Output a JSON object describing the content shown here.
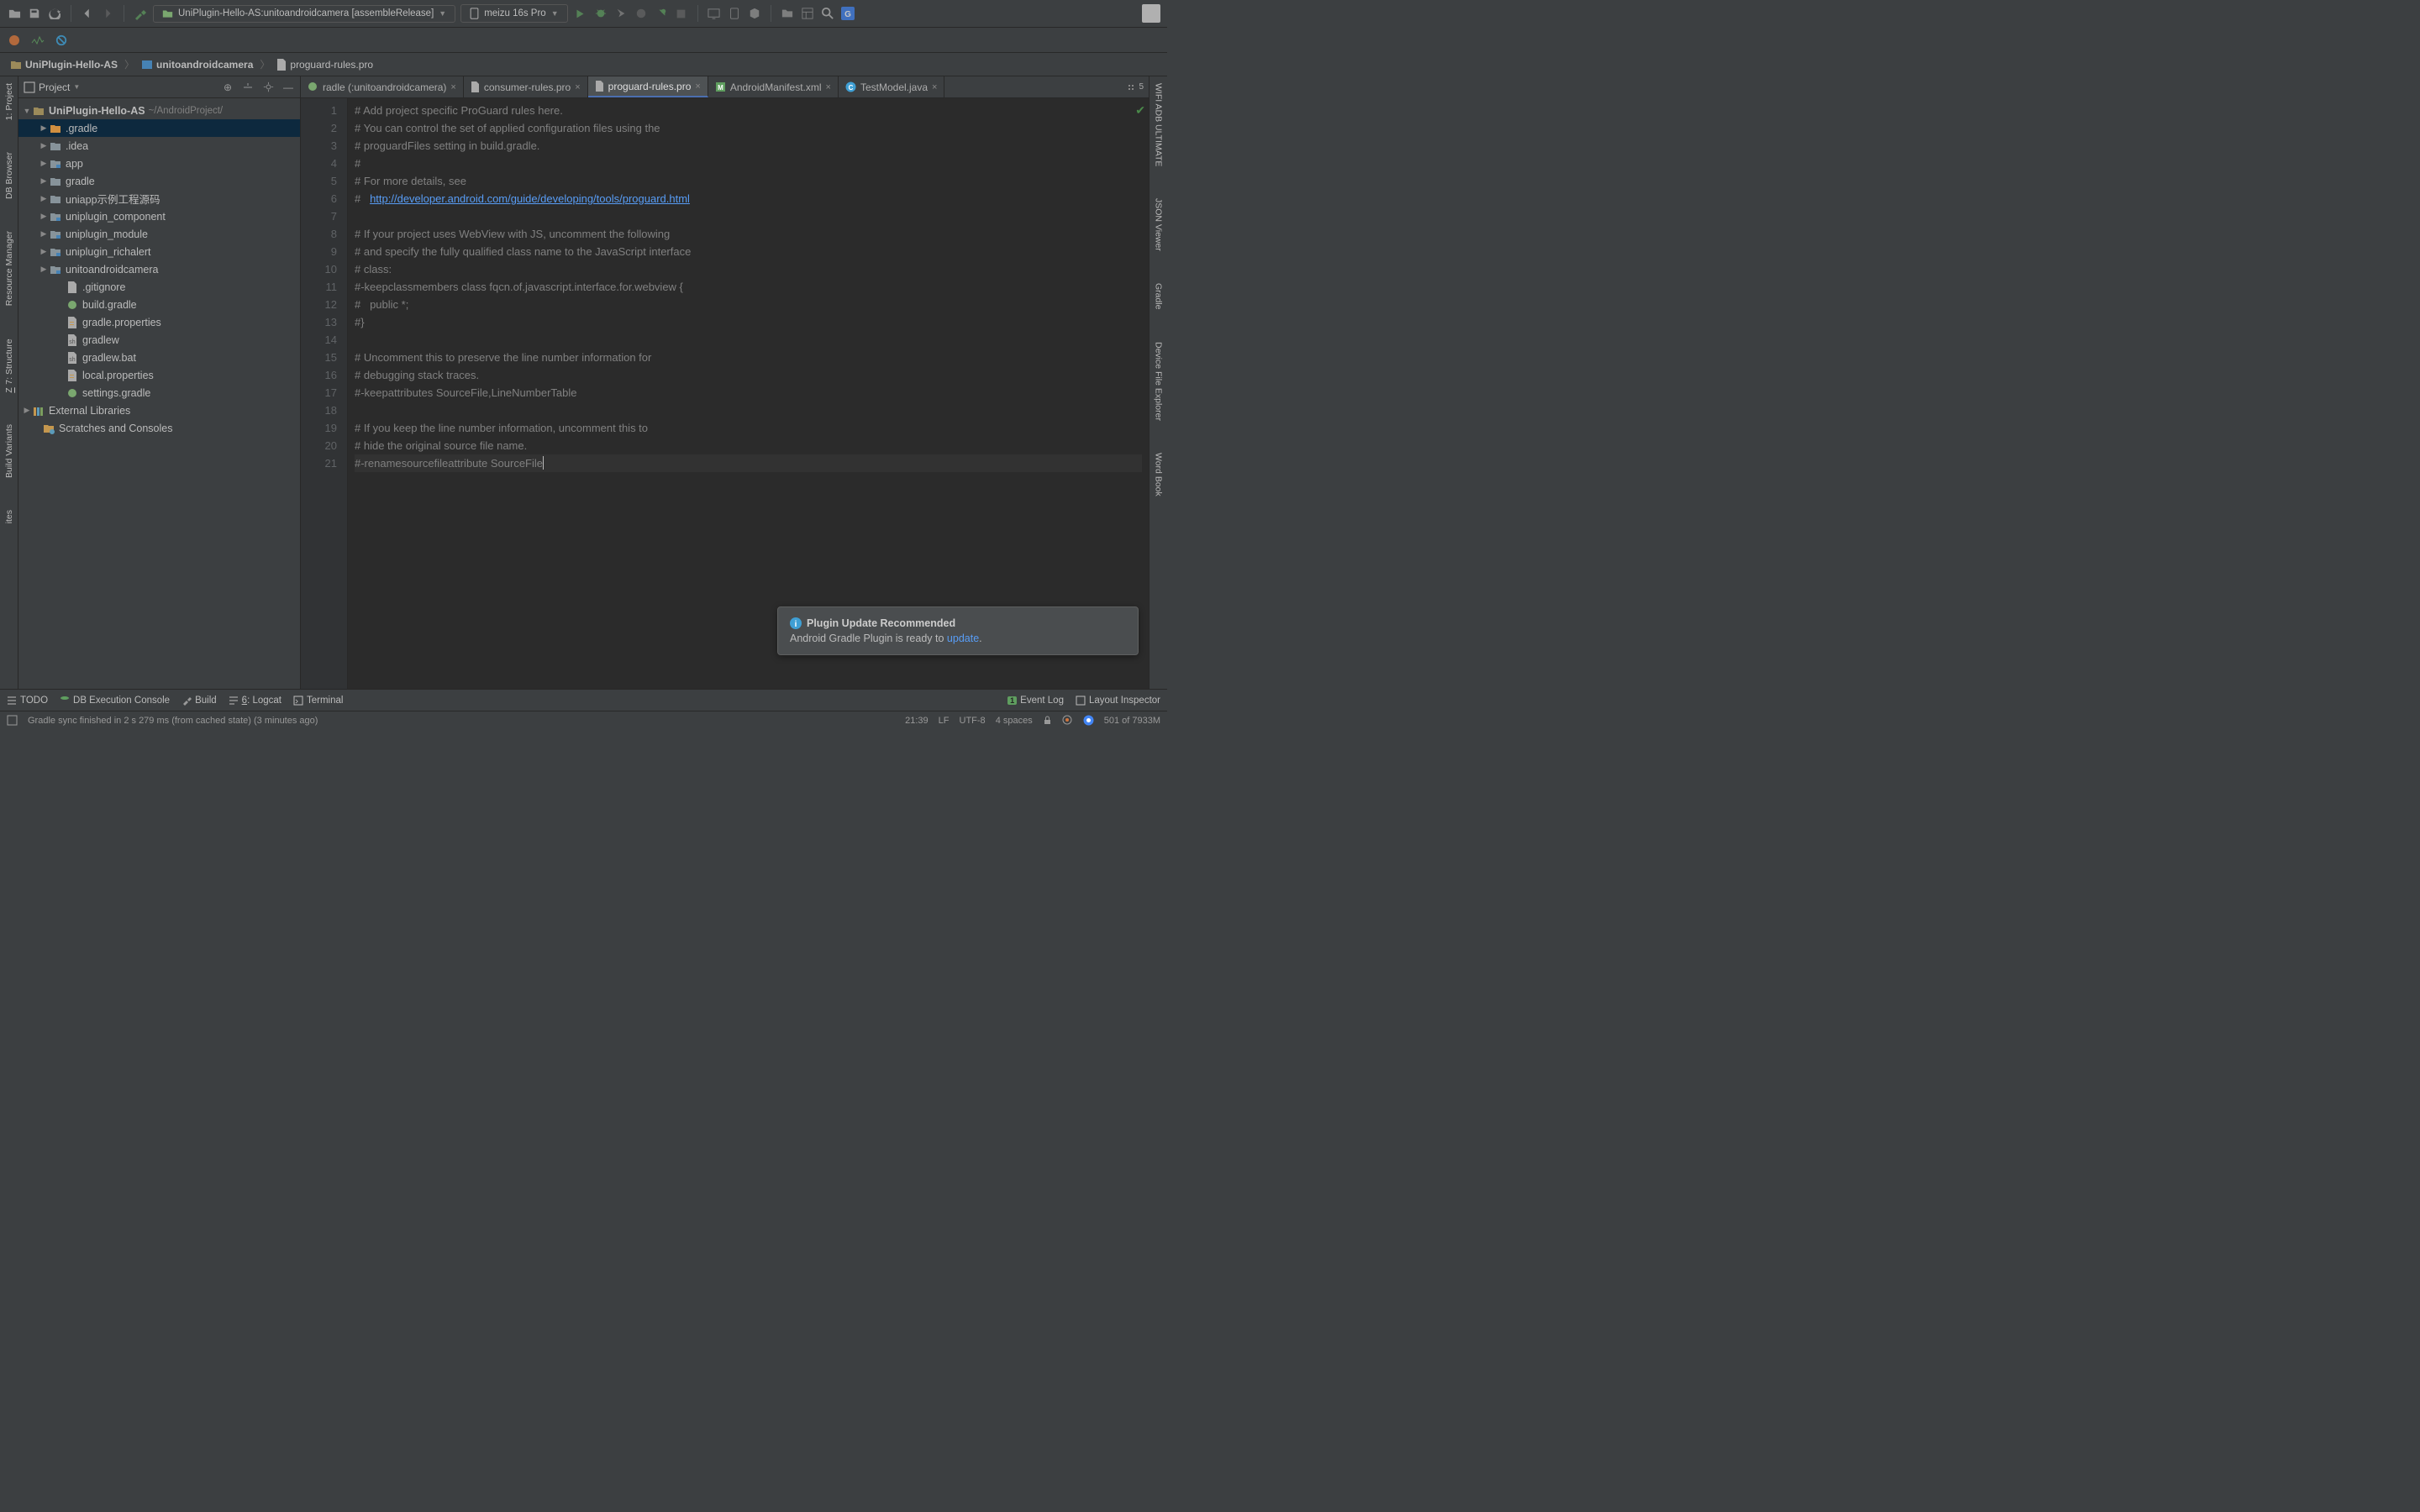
{
  "toolbar": {
    "config": "UniPlugin-Hello-AS:unitoandroidcamera [assembleRelease]",
    "device": "meizu 16s Pro"
  },
  "breadcrumb": {
    "project": "UniPlugin-Hello-AS",
    "module": "unitoandroidcamera",
    "file": "proguard-rules.pro"
  },
  "project": {
    "header": "Project",
    "root": "UniPlugin-Hello-AS",
    "root_path": "~/AndroidProject/",
    "items": [
      {
        "name": ".gradle",
        "type": "folder-orange",
        "expandable": true,
        "indent": 1
      },
      {
        "name": ".idea",
        "type": "folder",
        "expandable": true,
        "indent": 1
      },
      {
        "name": "app",
        "type": "module",
        "expandable": true,
        "indent": 1
      },
      {
        "name": "gradle",
        "type": "folder",
        "expandable": true,
        "indent": 1
      },
      {
        "name": "uniapp示例工程源码",
        "type": "folder",
        "expandable": true,
        "indent": 1
      },
      {
        "name": "uniplugin_component",
        "type": "module",
        "expandable": true,
        "indent": 1
      },
      {
        "name": "uniplugin_module",
        "type": "module",
        "expandable": true,
        "indent": 1
      },
      {
        "name": "uniplugin_richalert",
        "type": "module",
        "expandable": true,
        "indent": 1
      },
      {
        "name": "unitoandroidcamera",
        "type": "module",
        "expandable": true,
        "indent": 1
      },
      {
        "name": ".gitignore",
        "type": "file",
        "expandable": false,
        "indent": 2
      },
      {
        "name": "build.gradle",
        "type": "gradle",
        "expandable": false,
        "indent": 2
      },
      {
        "name": "gradle.properties",
        "type": "props",
        "expandable": false,
        "indent": 2
      },
      {
        "name": "gradlew",
        "type": "sh",
        "expandable": false,
        "indent": 2
      },
      {
        "name": "gradlew.bat",
        "type": "sh",
        "expandable": false,
        "indent": 2
      },
      {
        "name": "local.properties",
        "type": "props",
        "expandable": false,
        "indent": 2
      },
      {
        "name": "settings.gradle",
        "type": "gradle",
        "expandable": false,
        "indent": 2
      }
    ],
    "external": "External Libraries",
    "scratches": "Scratches and Consoles"
  },
  "tabs": [
    {
      "label": "radle (:unitoandroidcamera)",
      "icon": "gradle",
      "active": false
    },
    {
      "label": "consumer-rules.pro",
      "icon": "file",
      "active": false
    },
    {
      "label": "proguard-rules.pro",
      "icon": "file",
      "active": true
    },
    {
      "label": "AndroidManifest.xml",
      "icon": "manifest",
      "active": false
    },
    {
      "label": "TestModel.java",
      "icon": "java",
      "active": false
    }
  ],
  "tabs_more": "5",
  "code_lines": [
    "# Add project specific ProGuard rules here.",
    "# You can control the set of applied configuration files using the",
    "# proguardFiles setting in build.gradle.",
    "#",
    "# For more details, see",
    "#   http://developer.android.com/guide/developing/tools/proguard.html",
    "",
    "# If your project uses WebView with JS, uncomment the following",
    "# and specify the fully qualified class name to the JavaScript interface",
    "# class:",
    "#-keepclassmembers class fqcn.of.javascript.interface.for.webview {",
    "#   public *;",
    "#}",
    "",
    "# Uncomment this to preserve the line number information for",
    "# debugging stack traces.",
    "#-keepattributes SourceFile,LineNumberTable",
    "",
    "# If you keep the line number information, uncomment this to",
    "# hide the original source file name.",
    "#-renamesourcefileattribute SourceFile"
  ],
  "notification": {
    "title": "Plugin Update Recommended",
    "body_pre": "Android Gradle Plugin is ready to ",
    "body_link": "update",
    "body_post": "."
  },
  "left_tabs": {
    "project": "1: Project",
    "db": "DB Browser",
    "resource": "Resource Manager",
    "structure": "7: Structure",
    "build": "Build Variants",
    "fav": "ites"
  },
  "right_tabs": {
    "wifi": "WIFI ADB ULTIMATE",
    "json": "JSON Viewer",
    "gradle": "Gradle",
    "device": "Device File Explorer",
    "word": "Word Book"
  },
  "bottom_tabs": {
    "todo": "TODO",
    "db": "DB Execution Console",
    "build": "Build",
    "logcat": "6: Logcat",
    "terminal": "Terminal",
    "event": "Event Log",
    "layout": "Layout Inspector"
  },
  "status": {
    "msg": "Gradle sync finished in 2 s 279 ms (from cached state) (3 minutes ago)",
    "pos": "21:39",
    "sep": "LF",
    "enc": "UTF-8",
    "indent": "4 spaces",
    "mem": "501 of 7933M"
  }
}
